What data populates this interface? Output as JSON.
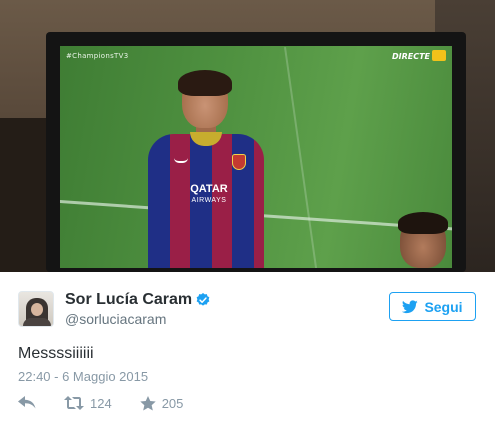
{
  "photo": {
    "tv_overlay_left": "#ChampionsTV3",
    "tv_overlay_right": "DIRECTE",
    "shirt_sponsor": "QATAR",
    "shirt_sponsor_sub": "AIRWAYS"
  },
  "tweet": {
    "author_name": "Sor Lucía Caram",
    "author_handle": "@sorluciacaram",
    "verified": true,
    "follow_label": "Segui",
    "text": "Messssiiiiii",
    "timestamp": "22:40 - 6 Maggio 2015",
    "actions": {
      "reply_icon": "reply-icon",
      "retweet_icon": "retweet-icon",
      "retweet_count": "124",
      "like_icon": "star-icon",
      "like_count": "205"
    }
  },
  "colors": {
    "accent": "#1da1f2",
    "text": "#292f33",
    "muted": "#8899a6",
    "handle": "#66757f"
  }
}
